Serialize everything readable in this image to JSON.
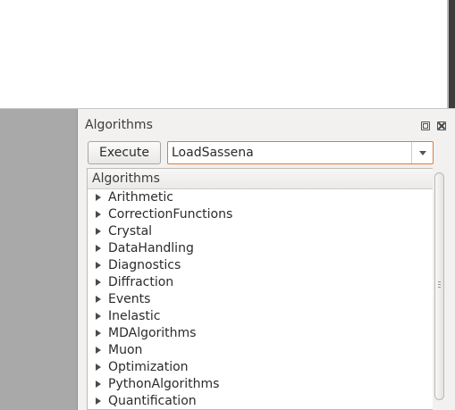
{
  "dock": {
    "title": "Algorithms",
    "execute_label": "Execute",
    "search_value": "LoadSassena"
  },
  "tree": {
    "header": "Algorithms",
    "items": [
      "Arithmetic",
      "CorrectionFunctions",
      "Crystal",
      "DataHandling",
      "Diagnostics",
      "Diffraction",
      "Events",
      "Inelastic",
      "MDAlgorithms",
      "Muon",
      "Optimization",
      "PythonAlgorithms",
      "Quantification"
    ]
  },
  "colors": {
    "accent_border": "#e07a3b",
    "left_panel": "#a9a9a9",
    "dock_background": "#f2f1f0"
  }
}
